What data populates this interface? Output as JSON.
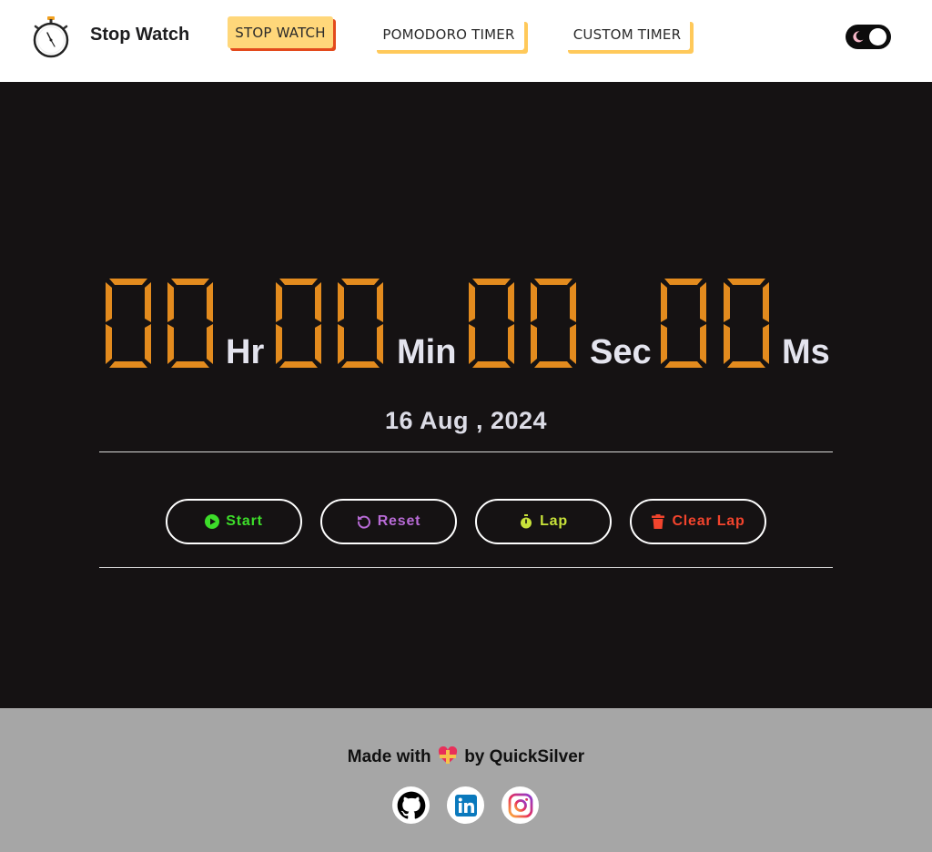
{
  "header": {
    "app_title": "Stop Watch",
    "nav": [
      {
        "label": "STOP WATCH",
        "active": true
      },
      {
        "label": "POMODORO TIMER",
        "active": false
      },
      {
        "label": "CUSTOM TIMER",
        "active": false
      }
    ],
    "theme_toggle": {
      "mode": "dark",
      "icon": "moon-icon"
    }
  },
  "timer": {
    "hours": "00",
    "minutes": "00",
    "seconds": "00",
    "milliseconds": "00",
    "units": {
      "hours": "Hr",
      "minutes": "Min",
      "seconds": "Sec",
      "milliseconds": "Ms"
    },
    "digit_color": "#e38b1e"
  },
  "date": "16 Aug , 2024",
  "controls": {
    "start": {
      "label": "Start",
      "icon": "play-circle-icon",
      "color": "#3ddc2a"
    },
    "reset": {
      "label": "Reset",
      "icon": "rotate-left-icon",
      "color": "#b86bd6"
    },
    "lap": {
      "label": "Lap",
      "icon": "stopwatch-icon",
      "color": "#c8e23a"
    },
    "clear_lap": {
      "label": "Clear Lap",
      "icon": "trash-icon",
      "color": "#f2442d"
    }
  },
  "footer": {
    "made_with_prefix": "Made with",
    "made_with_suffix": "by QuickSilver",
    "social": [
      "github-icon",
      "linkedin-icon",
      "instagram-icon"
    ]
  }
}
